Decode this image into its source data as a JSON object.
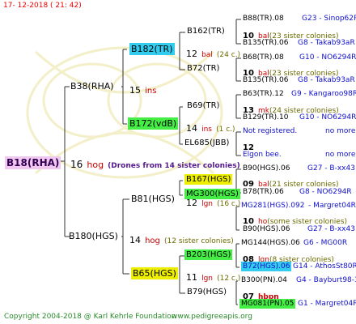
{
  "header": {
    "date": "17- 12-2018 ( 21: 42)"
  },
  "footer": {
    "copyright": "Copyright 2004-2018 @ Karl Kehrle Foundation",
    "website": "www.pedigreeapis.org"
  },
  "colors": {
    "cyan": "#33ccee",
    "green": "#44ee44",
    "yellow": "#eeee00",
    "pink": "#f0c8f0",
    "num_red": "#cc0000",
    "code_blue": "#1010cc",
    "line": "#333333"
  },
  "root": {
    "name": "B18(RHA)",
    "num": "16",
    "word": "hog",
    "note": "(Drones from 14 sister colonies)"
  },
  "gen1": [
    {
      "name": "B38(RHA)",
      "num": "15",
      "word": "ins",
      "note": ""
    },
    {
      "name": "B180(HGS)",
      "num": "14",
      "word": "hog",
      "note": "(12 sister colonies)"
    }
  ],
  "gen2": [
    {
      "name": "B182(TR)",
      "num": "12",
      "word": "bal",
      "note": "(24 c.)"
    },
    {
      "name": "B172(vdB)",
      "num": "14",
      "word": "ins",
      "note": "(1 c.)"
    },
    {
      "name": "B81(HGS)",
      "num": "12",
      "word": "lgn",
      "note": "(16 c.)"
    },
    {
      "name": "B65(HGS)",
      "num": "11",
      "word": "lgn",
      "note": "(12 c.)"
    }
  ],
  "gen3": [
    {
      "name": "B162(TR)",
      "num": "10",
      "word": "bal",
      "note": "(23 sister colonies)"
    },
    {
      "name": "B72(TR)",
      "num": "10",
      "word": "bal",
      "note": "(23 sister colonies)"
    },
    {
      "name": "B69(TR)",
      "num": "13",
      "word": "mk",
      "note": "(24 sister colonies)"
    },
    {
      "name": "EL685(JBB)",
      "num": "12",
      "word": "",
      "note": ""
    },
    {
      "name": "B167(HGS)",
      "num": "09",
      "word": "bal",
      "note": "(21 sister colonies)"
    },
    {
      "name": "MG300(HGS)",
      "num": "10",
      "word": "ho",
      "note": "(some sister colonies)"
    },
    {
      "name": "B203(HGS)",
      "num": "08",
      "word": "lgn",
      "note": "(8 sister colonies)"
    },
    {
      "name": "B79(HGS)",
      "num": "07",
      "word": "hbpn",
      "note": ""
    }
  ],
  "gen4": [
    {
      "name": "B88(TR).08",
      "code": "G23 - Sinop62R"
    },
    {
      "name": "B135(TR).06",
      "code": "G8 - Takab93aR"
    },
    {
      "name": "B68(TR).08",
      "code": "G10 - NO6294R"
    },
    {
      "name": "B135(TR).06",
      "code": "G8 - Takab93aR"
    },
    {
      "name": "B63(TR).12",
      "code": "G9 - Kangaroo98R"
    },
    {
      "name": "B129(TR).10",
      "code": "G10 - NO6294R"
    },
    {
      "name": "Not registered.",
      "code": "no more"
    },
    {
      "name": "Elgon bee.",
      "code": "no more"
    },
    {
      "name": "B90(HGS).06",
      "code": "G27 - B-xx43"
    },
    {
      "name": "B78(TR).06",
      "code": "G8 - NO6294R"
    },
    {
      "name": "MG281(HGS).092",
      "code": "- Margret04R"
    },
    {
      "name": "B90(HGS).06",
      "code": "G27 - B-xx43"
    },
    {
      "name": "MG144(HGS).06",
      "code": "G6 - MG00R"
    },
    {
      "name": "B72(HGS).06",
      "code": "G14 - AthosSt80R"
    },
    {
      "name": "B300(PN).04",
      "code": "G4 - Bayburt98-3"
    },
    {
      "name": "MG081(PN).05",
      "code": "G1 - Margret04R"
    }
  ]
}
